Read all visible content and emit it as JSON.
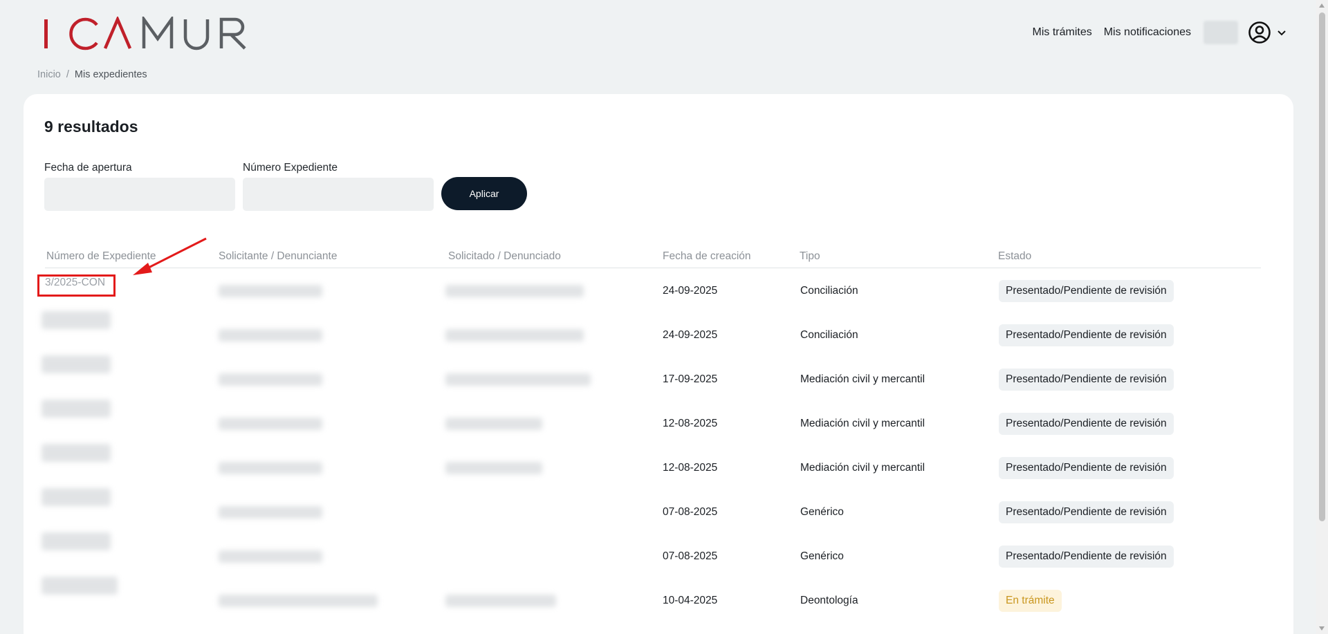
{
  "brand": {
    "logo_text": "ICAMUR",
    "logo_color_primary": "#c0202a",
    "logo_color_secondary": "#5b5f63"
  },
  "nav": {
    "tramites": "Mis trámites",
    "notificaciones": "Mis notificaciones"
  },
  "breadcrumb": {
    "home": "Inicio",
    "separator": "/",
    "current": "Mis expedientes"
  },
  "results": {
    "count_label": "9 resultados"
  },
  "filters": {
    "fecha_label": "Fecha de apertura",
    "fecha_value": "",
    "numero_label": "Número Expediente",
    "numero_value": "",
    "apply_label": "Aplicar"
  },
  "table": {
    "headers": [
      "Número de Expediente",
      "Solicitante / Denunciante",
      "Solicitado / Denunciado",
      "Fecha de creación",
      "Tipo",
      "Estado"
    ],
    "rows": [
      {
        "numero": "3/2025-CON",
        "fecha": "24-09-2025",
        "tipo": "Conciliación",
        "estado": "Presentado/Pendiente de revisión",
        "estado_kind": "pending"
      },
      {
        "numero": "",
        "fecha": "24-09-2025",
        "tipo": "Conciliación",
        "estado": "Presentado/Pendiente de revisión",
        "estado_kind": "pending"
      },
      {
        "numero": "",
        "fecha": "17-09-2025",
        "tipo": "Mediación civil y mercantil",
        "estado": "Presentado/Pendiente de revisión",
        "estado_kind": "pending"
      },
      {
        "numero": "",
        "fecha": "12-08-2025",
        "tipo": "Mediación civil y mercantil",
        "estado": "Presentado/Pendiente de revisión",
        "estado_kind": "pending"
      },
      {
        "numero": "",
        "fecha": "12-08-2025",
        "tipo": "Mediación civil y mercantil",
        "estado": "Presentado/Pendiente de revisión",
        "estado_kind": "pending"
      },
      {
        "numero": "",
        "fecha": "07-08-2025",
        "tipo": "Genérico",
        "estado": "Presentado/Pendiente de revisión",
        "estado_kind": "pending"
      },
      {
        "numero": "",
        "fecha": "07-08-2025",
        "tipo": "Genérico",
        "estado": "Presentado/Pendiente de revisión",
        "estado_kind": "pending"
      },
      {
        "numero": "",
        "fecha": "10-04-2025",
        "tipo": "Deontología",
        "estado": "En trámite",
        "estado_kind": "in-progress"
      }
    ]
  },
  "icons": {
    "user": "user-circle-icon",
    "chevron": "chevron-down-icon"
  },
  "colors": {
    "annotation": "#e31a1a",
    "primary_button": "#0d1b2a",
    "badge_pending": "#eef1f3",
    "badge_in_progress": "#fdf3dc"
  }
}
